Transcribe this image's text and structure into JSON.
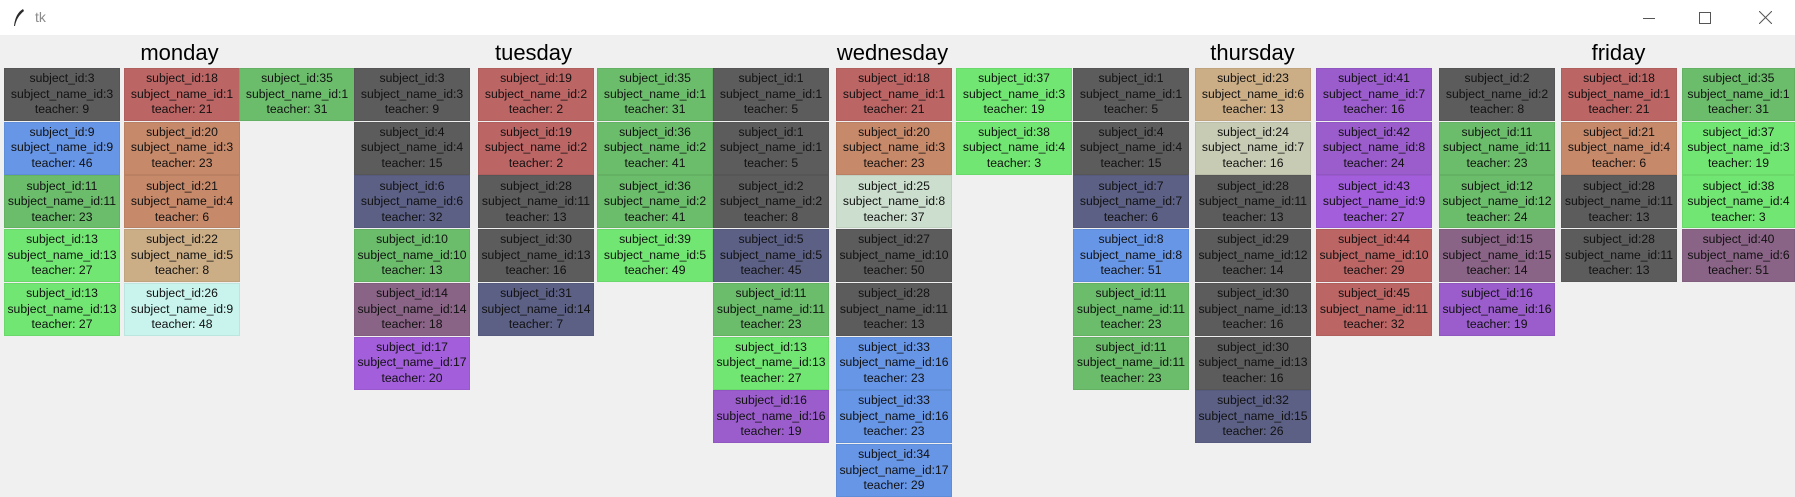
{
  "window": {
    "title": "tk"
  },
  "colors": {
    "dark": "#5c5c5c",
    "red": "#bc6565",
    "green": "#6bbd6b",
    "blue": "#6796e6",
    "lime": "#72e672",
    "orange": "#c6896a",
    "tan": "#cbad86",
    "cyan": "#c9f4ee",
    "slate": "#5c6085",
    "mauve": "#8a6486",
    "purple": "#a35edb",
    "mint": "#ccdfce",
    "sage": "#c7cbb4",
    "violet": "#9b5dcc"
  },
  "days": [
    {
      "name": "monday",
      "columns": [
        [
          {
            "subject": "subject_id:3",
            "name": "subject_name_id:3",
            "teacher": "teacher: 9",
            "color": "dark"
          },
          {
            "subject": "subject_id:9",
            "name": "subject_name_id:9",
            "teacher": "teacher: 46",
            "color": "blue"
          },
          {
            "subject": "subject_id:11",
            "name": "subject_name_id:11",
            "teacher": "teacher: 23",
            "color": "green"
          },
          {
            "subject": "subject_id:13",
            "name": "subject_name_id:13",
            "teacher": "teacher: 27",
            "color": "lime"
          },
          {
            "subject": "subject_id:13",
            "name": "subject_name_id:13",
            "teacher": "teacher: 27",
            "color": "lime"
          }
        ],
        [
          {
            "subject": "subject_id:18",
            "name": "subject_name_id:1",
            "teacher": "teacher: 21",
            "color": "red"
          },
          {
            "subject": "subject_id:20",
            "name": "subject_name_id:3",
            "teacher": "teacher: 23",
            "color": "orange"
          },
          {
            "subject": "subject_id:21",
            "name": "subject_name_id:4",
            "teacher": "teacher: 6",
            "color": "orange"
          },
          {
            "subject": "subject_id:22",
            "name": "subject_name_id:5",
            "teacher": "teacher: 8",
            "color": "tan"
          },
          {
            "subject": "subject_id:26",
            "name": "subject_name_id:9",
            "teacher": "teacher: 48",
            "color": "cyan"
          }
        ],
        [
          {
            "subject": "subject_id:35",
            "name": "subject_name_id:1",
            "teacher": "teacher: 31",
            "color": "green"
          }
        ]
      ]
    },
    {
      "name": "tuesday",
      "columns": [
        [
          {
            "subject": "subject_id:3",
            "name": "subject_name_id:3",
            "teacher": "teacher: 9",
            "color": "dark"
          },
          {
            "subject": "subject_id:4",
            "name": "subject_name_id:4",
            "teacher": "teacher: 15",
            "color": "dark"
          },
          {
            "subject": "subject_id:6",
            "name": "subject_name_id:6",
            "teacher": "teacher: 32",
            "color": "slate"
          },
          {
            "subject": "subject_id:10",
            "name": "subject_name_id:10",
            "teacher": "teacher: 13",
            "color": "green"
          },
          {
            "subject": "subject_id:14",
            "name": "subject_name_id:14",
            "teacher": "teacher: 18",
            "color": "mauve"
          },
          {
            "subject": "subject_id:17",
            "name": "subject_name_id:17",
            "teacher": "teacher: 20",
            "color": "purple"
          }
        ],
        [
          {
            "subject": "subject_id:19",
            "name": "subject_name_id:2",
            "teacher": "teacher: 2",
            "color": "red"
          },
          {
            "subject": "subject_id:19",
            "name": "subject_name_id:2",
            "teacher": "teacher: 2",
            "color": "red"
          },
          {
            "subject": "subject_id:28",
            "name": "subject_name_id:11",
            "teacher": "teacher: 13",
            "color": "dark"
          },
          {
            "subject": "subject_id:30",
            "name": "subject_name_id:13",
            "teacher": "teacher: 16",
            "color": "dark"
          },
          {
            "subject": "subject_id:31",
            "name": "subject_name_id:14",
            "teacher": "teacher: 7",
            "color": "slate"
          }
        ],
        [
          {
            "subject": "subject_id:35",
            "name": "subject_name_id:1",
            "teacher": "teacher: 31",
            "color": "green"
          },
          {
            "subject": "subject_id:36",
            "name": "subject_name_id:2",
            "teacher": "teacher: 41",
            "color": "green"
          },
          {
            "subject": "subject_id:36",
            "name": "subject_name_id:2",
            "teacher": "teacher: 41",
            "color": "green"
          },
          {
            "subject": "subject_id:39",
            "name": "subject_name_id:5",
            "teacher": "teacher: 49",
            "color": "lime"
          }
        ]
      ]
    },
    {
      "name": "wednesday",
      "columns": [
        [
          {
            "subject": "subject_id:1",
            "name": "subject_name_id:1",
            "teacher": "teacher: 5",
            "color": "dark"
          },
          {
            "subject": "subject_id:1",
            "name": "subject_name_id:1",
            "teacher": "teacher: 5",
            "color": "dark"
          },
          {
            "subject": "subject_id:2",
            "name": "subject_name_id:2",
            "teacher": "teacher: 8",
            "color": "dark"
          },
          {
            "subject": "subject_id:5",
            "name": "subject_name_id:5",
            "teacher": "teacher: 45",
            "color": "slate"
          },
          {
            "subject": "subject_id:11",
            "name": "subject_name_id:11",
            "teacher": "teacher: 23",
            "color": "green"
          },
          {
            "subject": "subject_id:13",
            "name": "subject_name_id:13",
            "teacher": "teacher: 27",
            "color": "lime"
          },
          {
            "subject": "subject_id:16",
            "name": "subject_name_id:16",
            "teacher": "teacher: 19",
            "color": "violet"
          }
        ],
        [
          {
            "subject": "subject_id:18",
            "name": "subject_name_id:1",
            "teacher": "teacher: 21",
            "color": "red"
          },
          {
            "subject": "subject_id:20",
            "name": "subject_name_id:3",
            "teacher": "teacher: 23",
            "color": "orange"
          },
          {
            "subject": "subject_id:25",
            "name": "subject_name_id:8",
            "teacher": "teacher: 37",
            "color": "mint"
          },
          {
            "subject": "subject_id:27",
            "name": "subject_name_id:10",
            "teacher": "teacher: 50",
            "color": "dark"
          },
          {
            "subject": "subject_id:28",
            "name": "subject_name_id:11",
            "teacher": "teacher: 13",
            "color": "dark"
          },
          {
            "subject": "subject_id:33",
            "name": "subject_name_id:16",
            "teacher": "teacher: 23",
            "color": "blue"
          },
          {
            "subject": "subject_id:33",
            "name": "subject_name_id:16",
            "teacher": "teacher: 23",
            "color": "blue"
          },
          {
            "subject": "subject_id:34",
            "name": "subject_name_id:17",
            "teacher": "teacher: 29",
            "color": "blue"
          }
        ],
        [
          {
            "subject": "subject_id:37",
            "name": "subject_name_id:3",
            "teacher": "teacher: 19",
            "color": "lime"
          },
          {
            "subject": "subject_id:38",
            "name": "subject_name_id:4",
            "teacher": "teacher: 3",
            "color": "lime"
          }
        ]
      ]
    },
    {
      "name": "thursday",
      "columns": [
        [
          {
            "subject": "subject_id:1",
            "name": "subject_name_id:1",
            "teacher": "teacher: 5",
            "color": "dark"
          },
          {
            "subject": "subject_id:4",
            "name": "subject_name_id:4",
            "teacher": "teacher: 15",
            "color": "dark"
          },
          {
            "subject": "subject_id:7",
            "name": "subject_name_id:7",
            "teacher": "teacher: 6",
            "color": "slate"
          },
          {
            "subject": "subject_id:8",
            "name": "subject_name_id:8",
            "teacher": "teacher: 51",
            "color": "blue"
          },
          {
            "subject": "subject_id:11",
            "name": "subject_name_id:11",
            "teacher": "teacher: 23",
            "color": "green"
          },
          {
            "subject": "subject_id:11",
            "name": "subject_name_id:11",
            "teacher": "teacher: 23",
            "color": "green"
          }
        ],
        [
          {
            "subject": "subject_id:23",
            "name": "subject_name_id:6",
            "teacher": "teacher: 13",
            "color": "tan"
          },
          {
            "subject": "subject_id:24",
            "name": "subject_name_id:7",
            "teacher": "teacher: 16",
            "color": "sage"
          },
          {
            "subject": "subject_id:28",
            "name": "subject_name_id:11",
            "teacher": "teacher: 13",
            "color": "dark"
          },
          {
            "subject": "subject_id:29",
            "name": "subject_name_id:12",
            "teacher": "teacher: 14",
            "color": "dark"
          },
          {
            "subject": "subject_id:30",
            "name": "subject_name_id:13",
            "teacher": "teacher: 16",
            "color": "dark"
          },
          {
            "subject": "subject_id:30",
            "name": "subject_name_id:13",
            "teacher": "teacher: 16",
            "color": "dark"
          },
          {
            "subject": "subject_id:32",
            "name": "subject_name_id:15",
            "teacher": "teacher: 26",
            "color": "slate"
          }
        ],
        [
          {
            "subject": "subject_id:41",
            "name": "subject_name_id:7",
            "teacher": "teacher: 16",
            "color": "violet"
          },
          {
            "subject": "subject_id:42",
            "name": "subject_name_id:8",
            "teacher": "teacher: 24",
            "color": "violet"
          },
          {
            "subject": "subject_id:43",
            "name": "subject_name_id:9",
            "teacher": "teacher: 27",
            "color": "purple"
          },
          {
            "subject": "subject_id:44",
            "name": "subject_name_id:10",
            "teacher": "teacher: 29",
            "color": "red"
          },
          {
            "subject": "subject_id:45",
            "name": "subject_name_id:11",
            "teacher": "teacher: 32",
            "color": "red"
          }
        ]
      ]
    },
    {
      "name": "friday",
      "columns": [
        [
          {
            "subject": "subject_id:2",
            "name": "subject_name_id:2",
            "teacher": "teacher: 8",
            "color": "dark"
          },
          {
            "subject": "subject_id:11",
            "name": "subject_name_id:11",
            "teacher": "teacher: 23",
            "color": "green"
          },
          {
            "subject": "subject_id:12",
            "name": "subject_name_id:12",
            "teacher": "teacher: 24",
            "color": "green"
          },
          {
            "subject": "subject_id:15",
            "name": "subject_name_id:15",
            "teacher": "teacher: 14",
            "color": "mauve"
          },
          {
            "subject": "subject_id:16",
            "name": "subject_name_id:16",
            "teacher": "teacher: 19",
            "color": "violet"
          }
        ],
        [
          {
            "subject": "subject_id:18",
            "name": "subject_name_id:1",
            "teacher": "teacher: 21",
            "color": "red"
          },
          {
            "subject": "subject_id:21",
            "name": "subject_name_id:4",
            "teacher": "teacher: 6",
            "color": "orange"
          },
          {
            "subject": "subject_id:28",
            "name": "subject_name_id:11",
            "teacher": "teacher: 13",
            "color": "dark"
          },
          {
            "subject": "subject_id:28",
            "name": "subject_name_id:11",
            "teacher": "teacher: 13",
            "color": "dark"
          }
        ],
        [
          {
            "subject": "subject_id:35",
            "name": "subject_name_id:1",
            "teacher": "teacher: 31",
            "color": "green"
          },
          {
            "subject": "subject_id:37",
            "name": "subject_name_id:3",
            "teacher": "teacher: 19",
            "color": "lime"
          },
          {
            "subject": "subject_id:38",
            "name": "subject_name_id:4",
            "teacher": "teacher: 3",
            "color": "lime"
          },
          {
            "subject": "subject_id:40",
            "name": "subject_name_id:6",
            "teacher": "teacher: 51",
            "color": "mauve"
          }
        ]
      ]
    }
  ]
}
